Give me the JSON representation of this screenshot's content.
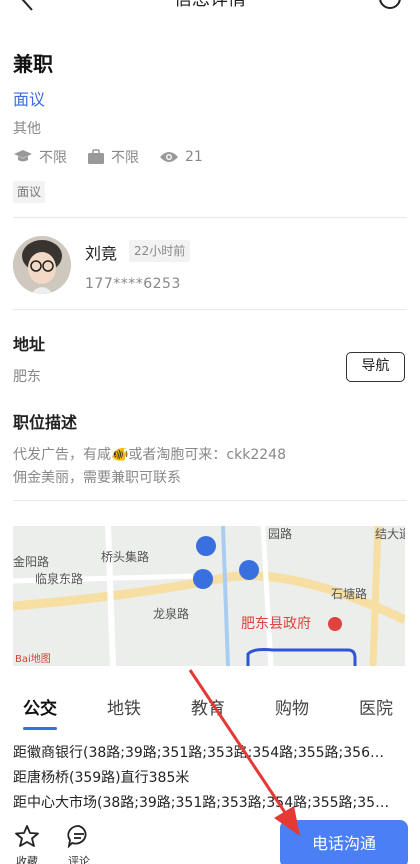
{
  "header": {
    "title": "信息详情",
    "back_icon": "chevron-left-icon",
    "more_icon": "more-circle-icon"
  },
  "job": {
    "title": "兼职",
    "salary": "面议",
    "category": "其他",
    "education": "不限",
    "experience": "不限",
    "views": "21",
    "tag": "面议"
  },
  "poster": {
    "name": "刘竟",
    "time": "22小时前",
    "phone": "177****6253"
  },
  "address": {
    "title": "地址",
    "value": "肥东",
    "nav_button": "导航"
  },
  "description": {
    "title": "职位描述",
    "line1": "代发广告，有咸🐠或者淘胞可来：ckk2248",
    "line2": "佣金美丽，需要兼职可联系"
  },
  "map": {
    "labels": {
      "road1": "桥头集路",
      "road2": "临泉东路",
      "road3": "金阳路",
      "road4": "龙泉路",
      "road5": "园路",
      "road6": "结大道",
      "road7": "石塘路",
      "poi": "肥东县政府",
      "brand": "Bai地图"
    }
  },
  "nearby": {
    "tabs": [
      "公交",
      "地铁",
      "教育",
      "购物",
      "医院"
    ],
    "active_tab": 0,
    "items": [
      "距徽商银行(38路;39路;351路;353路;354路;355路;356…",
      "距唐杨桥(359路)直行385米",
      "距中心大市场(38路;39路;351路;353路;354路;355路;35…"
    ]
  },
  "bottom": {
    "favorite": "收藏",
    "comment": "评论",
    "call": "电话沟通"
  },
  "colors": {
    "accent": "#3b6de0",
    "call_button": "#4a7ff5",
    "annotation_arrow": "#e53935"
  }
}
